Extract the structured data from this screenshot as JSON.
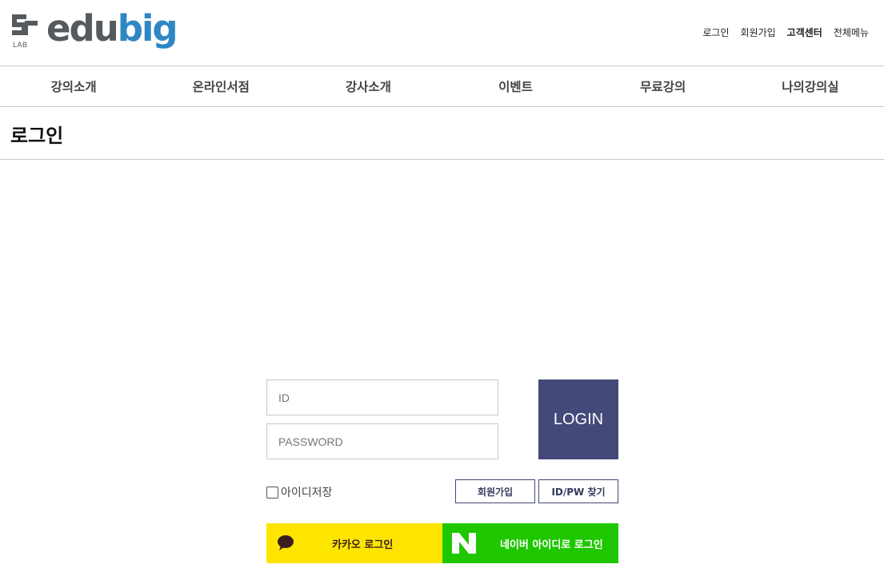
{
  "logo": {
    "word_part1": "edu",
    "word_part2": "big",
    "lab": "LAB"
  },
  "util_menu": [
    "로그인",
    "회원가입",
    "고객센터",
    "전체메뉴"
  ],
  "nav": [
    "강의소개",
    "온라인서점",
    "강사소개",
    "이벤트",
    "무료강의",
    "나의강의실"
  ],
  "page_title": "로그인",
  "form": {
    "id_placeholder": "ID",
    "pw_placeholder": "PASSWORD",
    "login_label": "LOGIN",
    "remember_label": "아이디저장",
    "join_label": "회원가입",
    "find_label": "ID/PW 찾기",
    "kakao_label": "카카오 로그인",
    "naver_label": "네이버 아이디로 로그인"
  },
  "colors": {
    "brand_gray": "#555a5f",
    "brand_blue": "#2f86c4",
    "login_button": "#434978",
    "kakao": "#fde500",
    "naver": "#1fc700"
  }
}
